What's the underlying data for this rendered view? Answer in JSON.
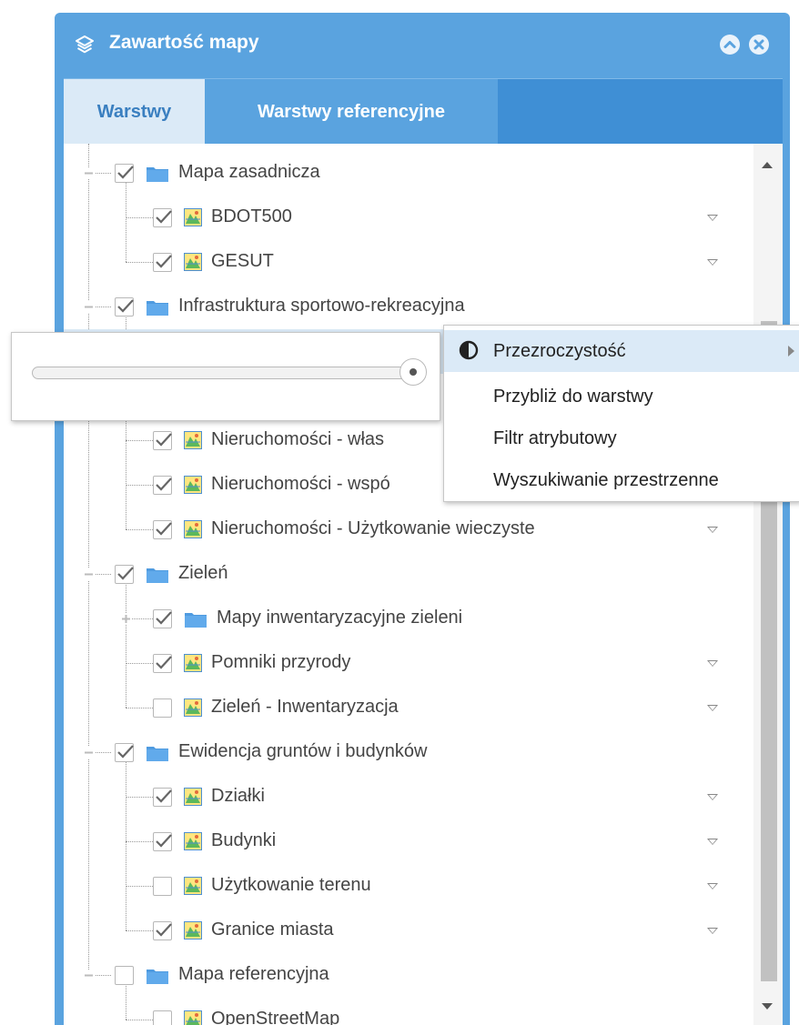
{
  "window": {
    "title": "Zawartość mapy",
    "icon": "layers-icon",
    "collapse_icon": "chevron-up-circle-icon",
    "close_icon": "close-circle-icon"
  },
  "tabs": [
    {
      "label": "Warstwy",
      "active": true
    },
    {
      "label": "Warstwy referencyjne",
      "active": false
    }
  ],
  "colors": {
    "header": "#5aa3df",
    "tabbar": "#3f8fd5",
    "active_tab_bg": "#dbeaf7",
    "active_tab_text": "#3a7fc0",
    "highlight": "#dbeaf7"
  },
  "tree": [
    {
      "label": "Mapa zasadnicza",
      "type": "group",
      "checked": true
    },
    {
      "label": "BDOT500",
      "type": "layer",
      "checked": true,
      "menu": true
    },
    {
      "label": "GESUT",
      "type": "layer",
      "checked": true,
      "menu": true
    },
    {
      "label": "Infrastruktura sportowo-rekreacyjna",
      "type": "group",
      "checked": true
    },
    {
      "label": "",
      "type": "layer",
      "checked": true,
      "selected": true
    },
    {
      "label": "",
      "type": "layer",
      "checked": true
    },
    {
      "label": "Nieruchomości - włas",
      "type": "layer",
      "checked": true
    },
    {
      "label": "Nieruchomości - wspó",
      "type": "layer",
      "checked": true
    },
    {
      "label": "Nieruchomości - Użytkowanie wieczyste",
      "type": "layer",
      "checked": true,
      "menu": true
    },
    {
      "label": "Zieleń",
      "type": "group",
      "checked": true
    },
    {
      "label": "Mapy inwentaryzacyjne zieleni",
      "type": "subgroup",
      "checked": true,
      "collapsed": true
    },
    {
      "label": "Pomniki przyrody",
      "type": "layer",
      "checked": true,
      "menu": true
    },
    {
      "label": "Zieleń - Inwentaryzacja",
      "type": "layer",
      "checked": false,
      "menu": true
    },
    {
      "label": "Ewidencja gruntów i budynków",
      "type": "group",
      "checked": true
    },
    {
      "label": "Działki",
      "type": "layer",
      "checked": true,
      "menu": true
    },
    {
      "label": "Budynki",
      "type": "layer",
      "checked": true,
      "menu": true
    },
    {
      "label": "Użytkowanie terenu",
      "type": "layer",
      "checked": false,
      "menu": true
    },
    {
      "label": "Granice miasta",
      "type": "layer",
      "checked": true,
      "menu": true
    },
    {
      "label": "Mapa referencyjna",
      "type": "group",
      "checked": false
    },
    {
      "label": "OpenStreetMap",
      "type": "layer",
      "checked": false
    }
  ],
  "opacity_slider": {
    "value": 1.0
  },
  "context_menu": [
    {
      "label": "Przezroczystość",
      "icon": "contrast-icon",
      "has_submenu": true,
      "hovered": true
    },
    {
      "label": "Przybliż do warstwy"
    },
    {
      "label": "Filtr atrybutowy"
    },
    {
      "label": "Wyszukiwanie przestrzenne"
    }
  ]
}
